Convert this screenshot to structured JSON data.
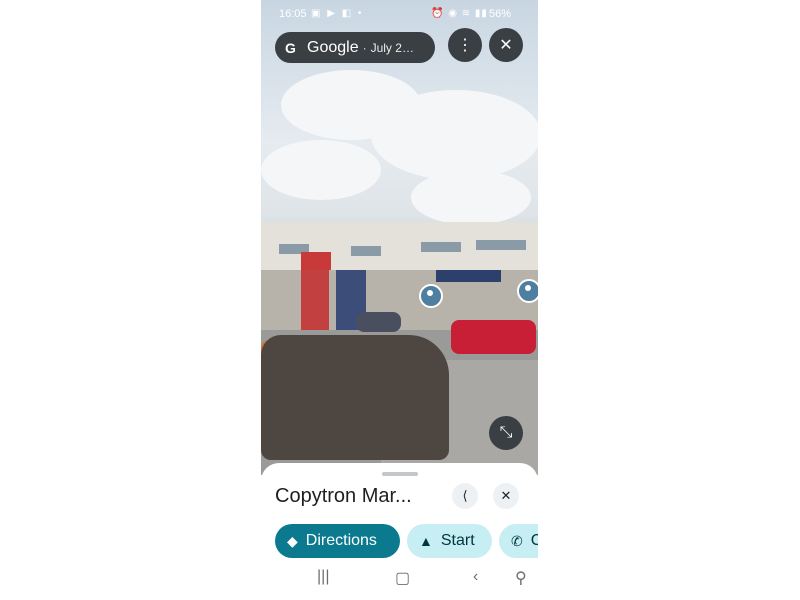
{
  "status_bar": {
    "time": "16:05",
    "left_icons": "▣ ▶ ◧ •",
    "right_icons": "⏰ ◉ ≋ ▮▮",
    "battery": "56%"
  },
  "header": {
    "brand": "Google",
    "separator": "·",
    "date": "July 2…",
    "menu_icon": "⋮",
    "close_icon": "✕"
  },
  "scene": {
    "collapse_icon": "⤡"
  },
  "sheet": {
    "place_name": "Copytron Mar...",
    "share_icon": "⟨",
    "close_icon": "✕",
    "actions": [
      {
        "icon": "◆",
        "label": "Directions"
      },
      {
        "icon": "▲",
        "label": "Start"
      },
      {
        "icon": "✆",
        "label": "C"
      }
    ]
  },
  "navbar": {
    "recents": "|||",
    "home": "▢",
    "back": "‹",
    "accessibility": "⚲"
  },
  "colors": {
    "accent": "#0b7a8f",
    "chip_tonal": "#c7eef3",
    "overlay_button": "#3a3f44"
  }
}
